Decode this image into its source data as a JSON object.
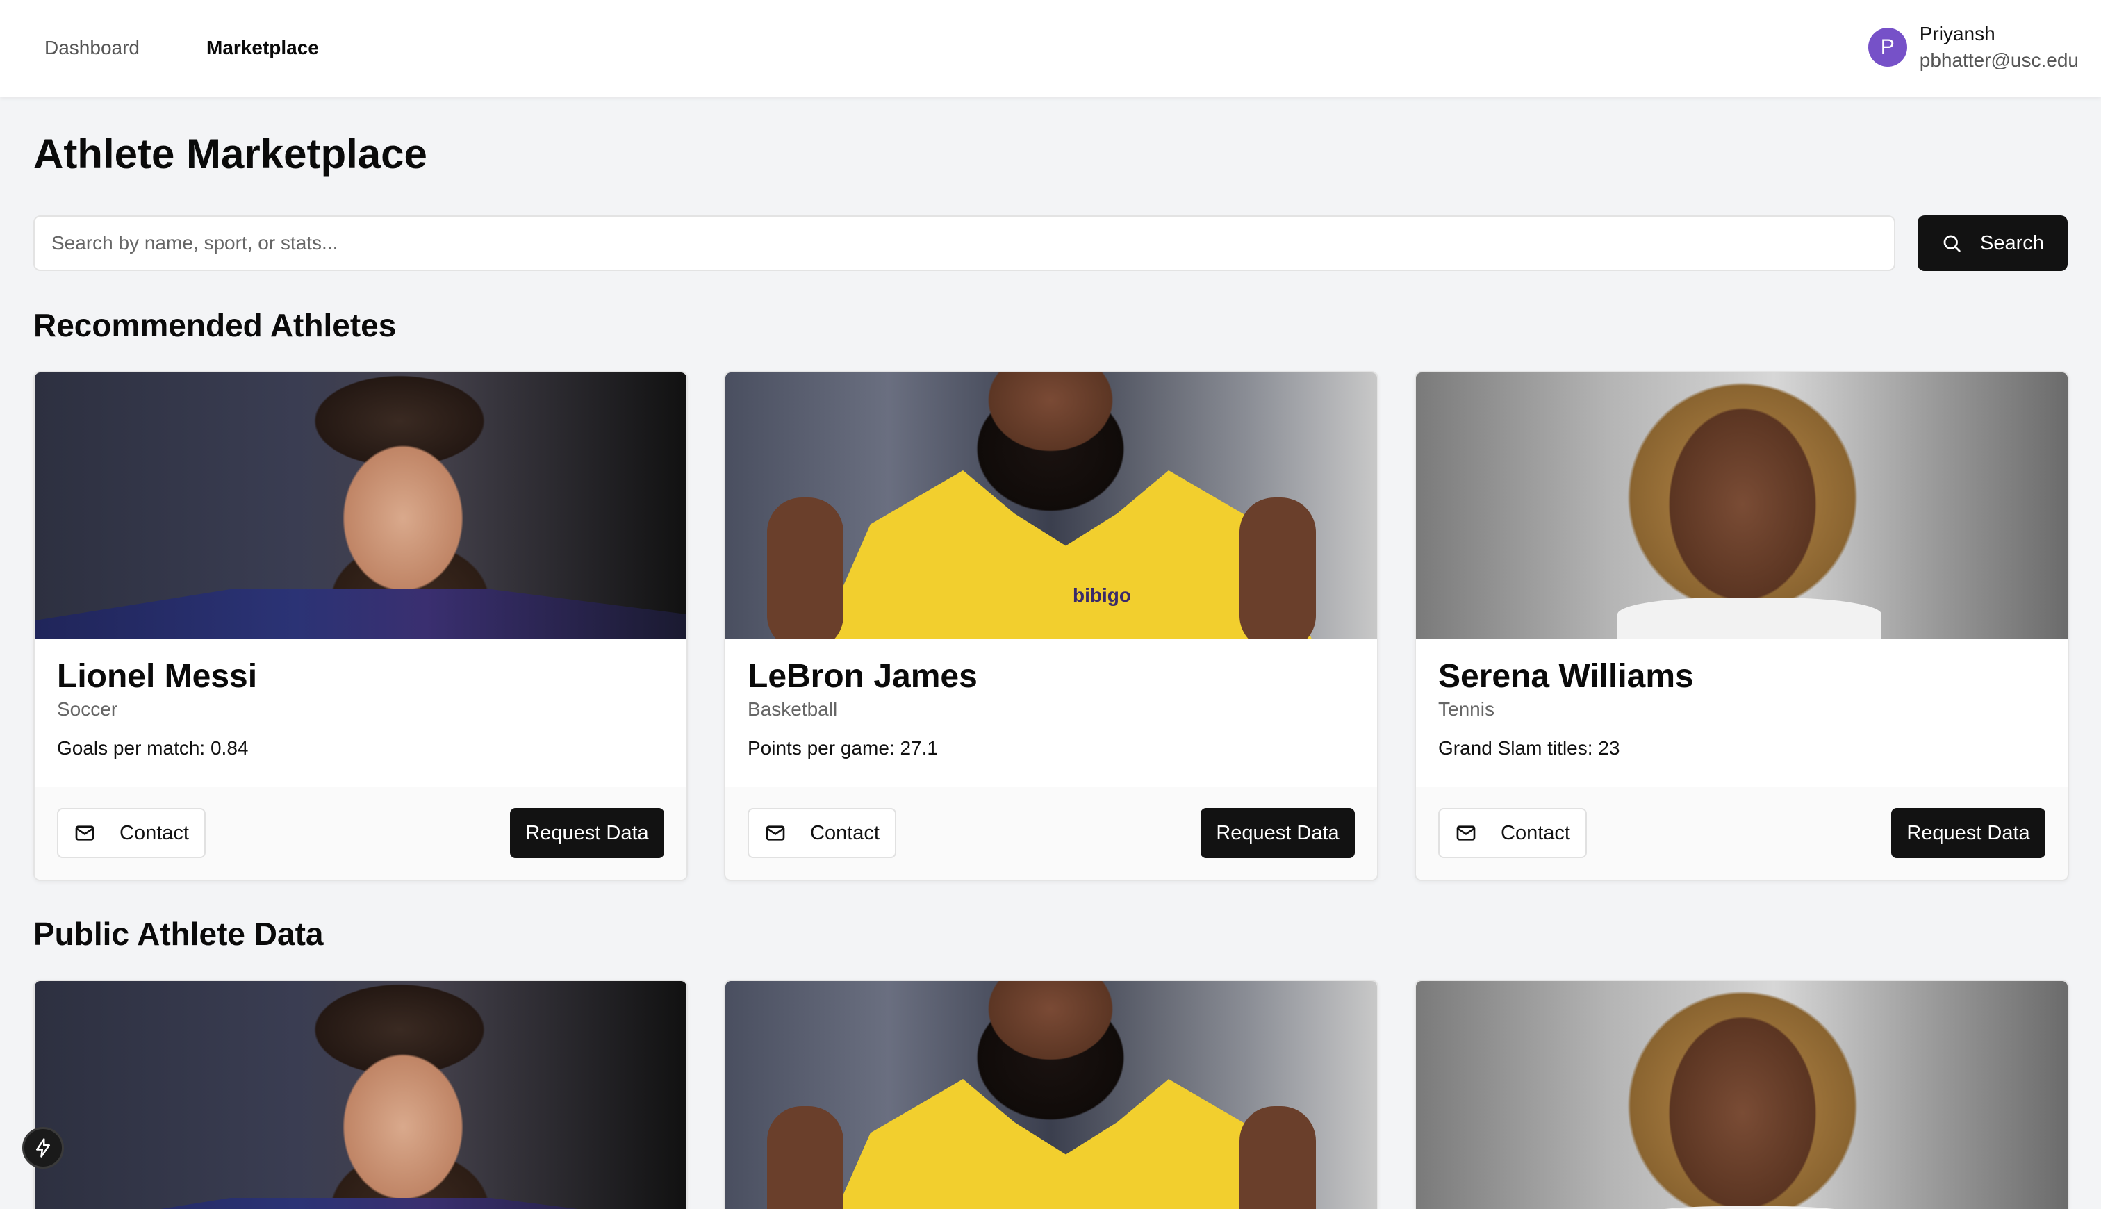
{
  "nav": {
    "dashboard": "Dashboard",
    "marketplace": "Marketplace"
  },
  "user": {
    "initial": "P",
    "name": "Priyansh",
    "email": "pbhatter@usc.edu",
    "avatar_color": "#7651c8"
  },
  "page": {
    "title": "Athlete Marketplace"
  },
  "search": {
    "placeholder": "Search by name, sport, or stats...",
    "value": "",
    "button_label": "Search",
    "button_icon": "search-icon"
  },
  "sections": {
    "recommended": {
      "title": "Recommended Athletes",
      "athletes": [
        {
          "name": "Lionel Messi",
          "sport": "Soccer",
          "stat": "Goals per match: 0.84",
          "contact_label": "Contact",
          "request_label": "Request Data"
        },
        {
          "name": "LeBron James",
          "sport": "Basketball",
          "stat": "Points per game: 27.1",
          "contact_label": "Contact",
          "request_label": "Request Data"
        },
        {
          "name": "Serena Williams",
          "sport": "Tennis",
          "stat": "Grand Slam titles: 23",
          "contact_label": "Contact",
          "request_label": "Request Data"
        }
      ]
    },
    "public": {
      "title": "Public Athlete Data"
    }
  },
  "photo_text": {
    "jersey_sponsor": "bibigo"
  },
  "colors": {
    "primary_button": "#121212",
    "background": "#f3f4f6"
  }
}
